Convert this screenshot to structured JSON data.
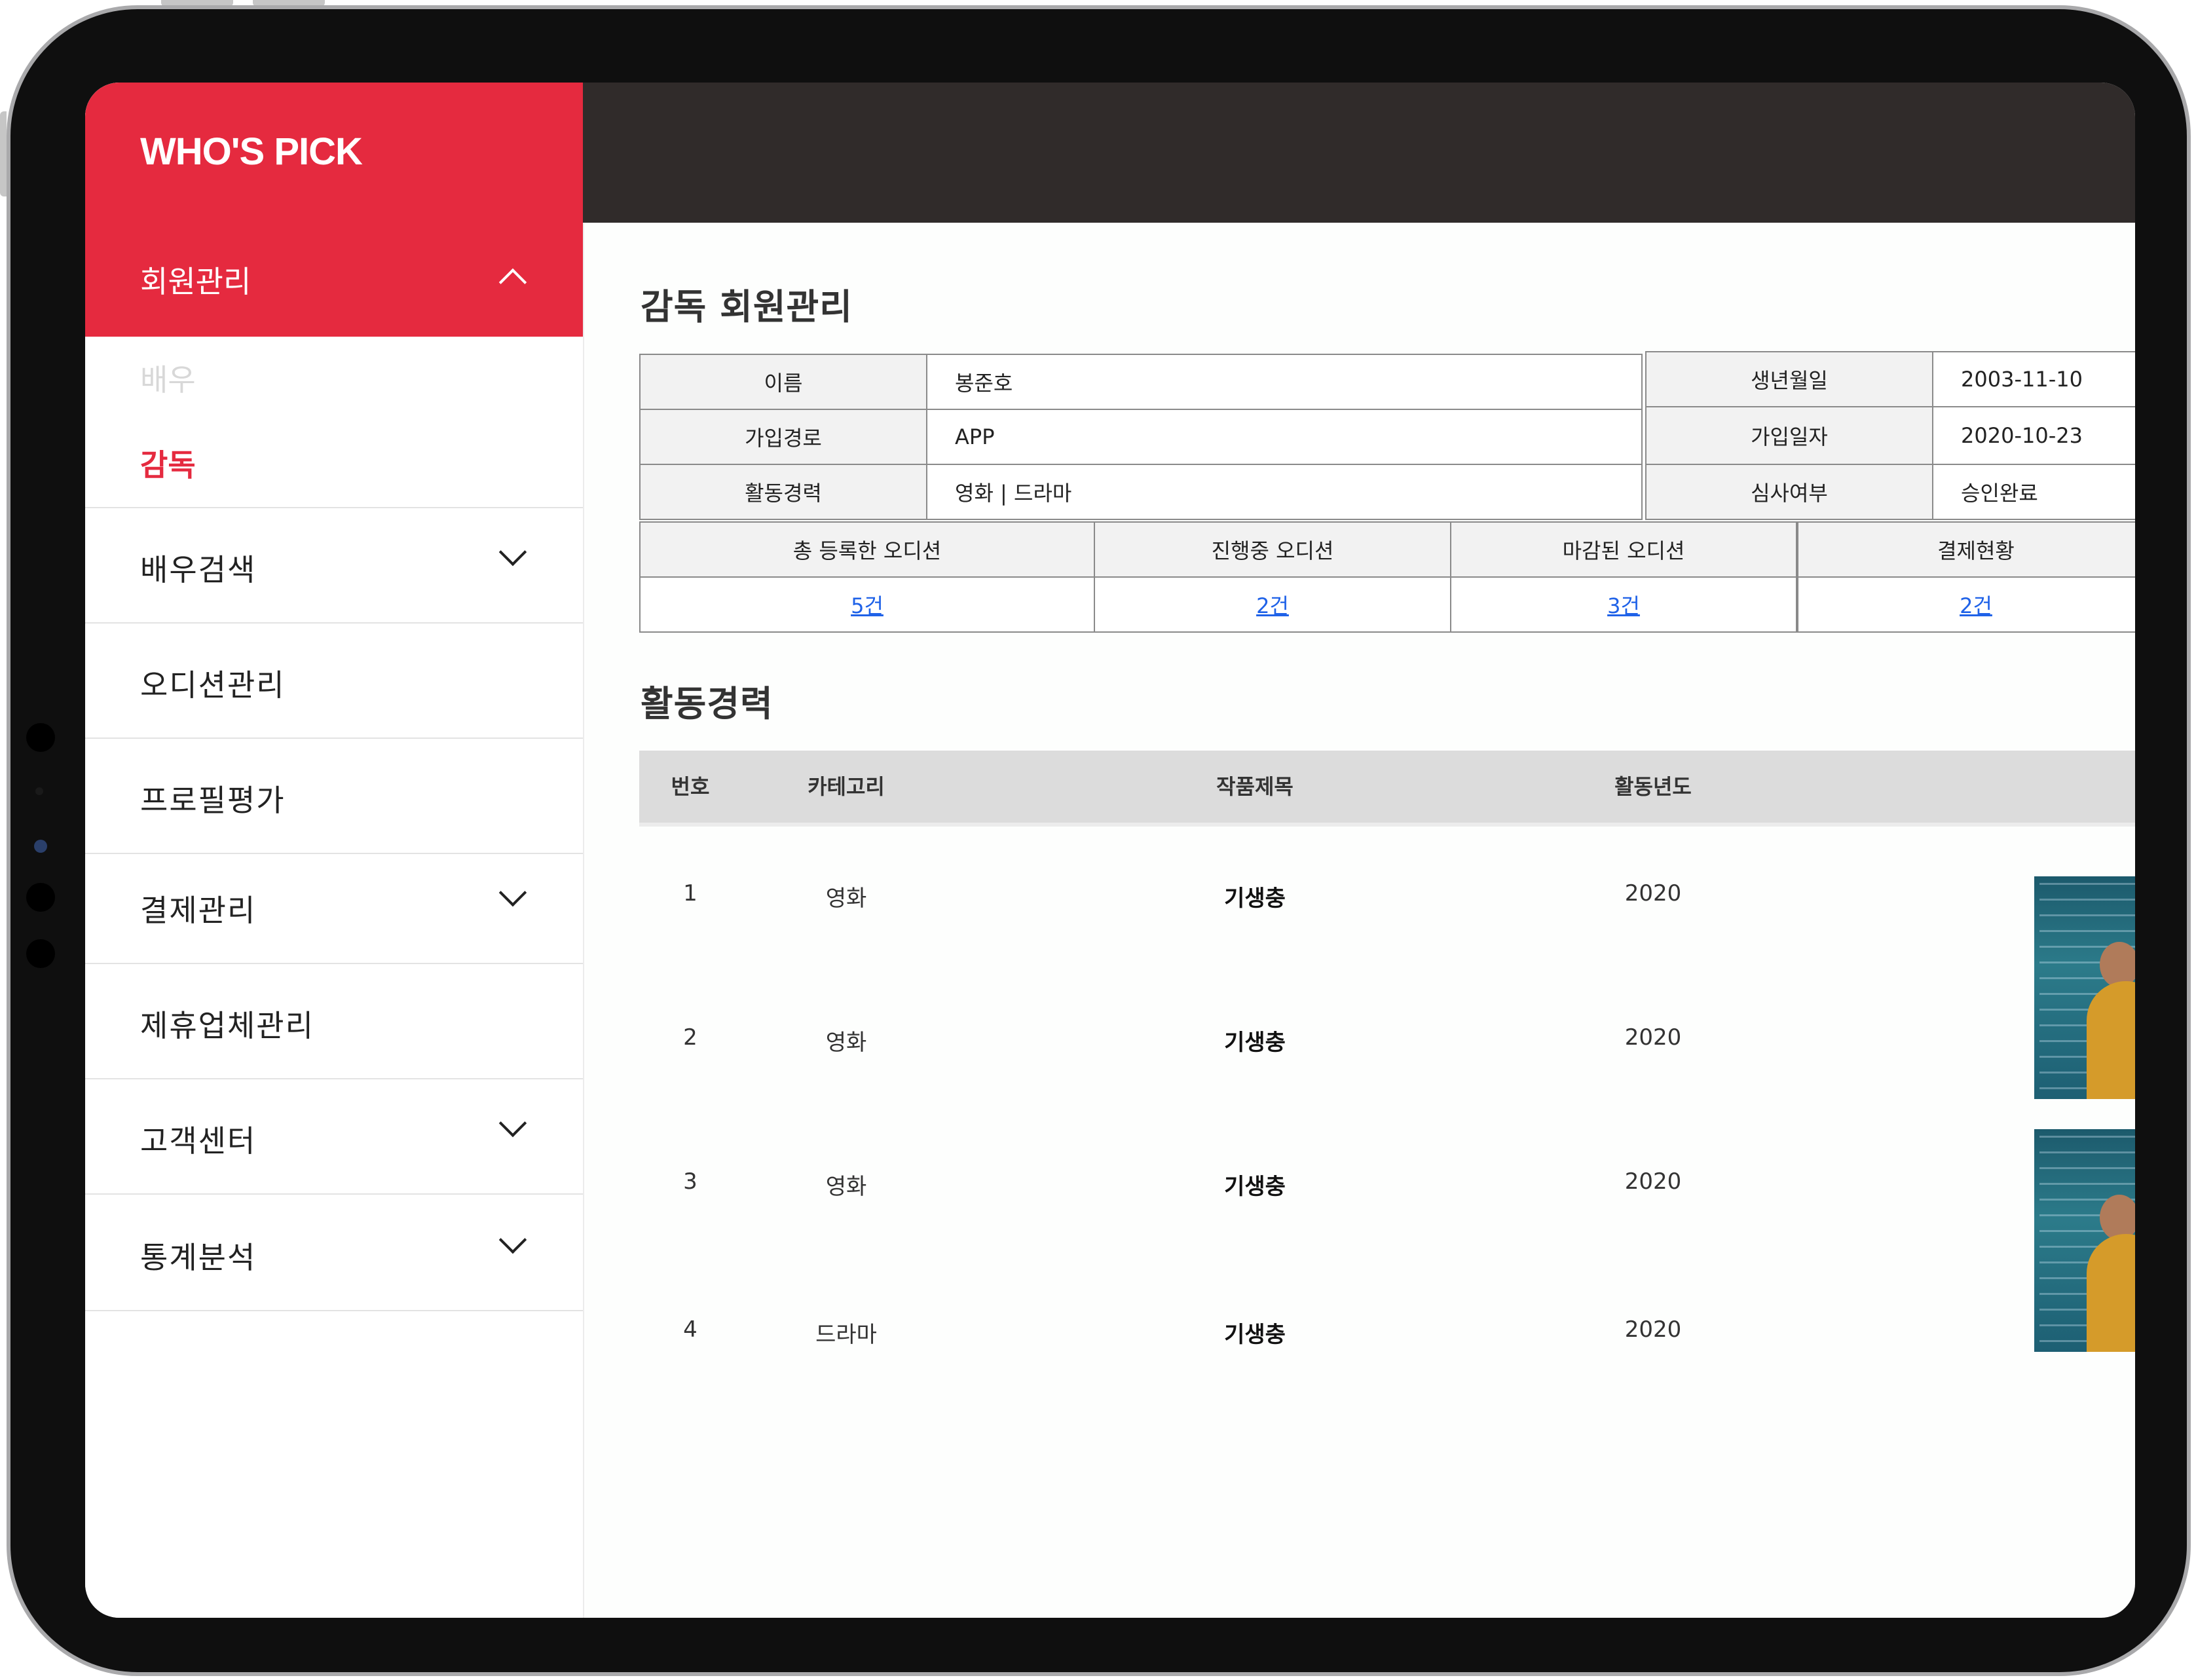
{
  "app": {
    "logo": "WHO'S PICK"
  },
  "sidebar": {
    "open_menu": "회원관리",
    "sub_items": [
      {
        "label": "배우",
        "active": false
      },
      {
        "label": "감독",
        "active": true
      }
    ],
    "items": [
      {
        "label": "배우검색",
        "has_chevron": true
      },
      {
        "label": "오디션관리",
        "has_chevron": false
      },
      {
        "label": "프로필평가",
        "has_chevron": false
      },
      {
        "label": "결제관리",
        "has_chevron": true
      },
      {
        "label": "제휴업체관리",
        "has_chevron": false
      },
      {
        "label": "고객센터",
        "has_chevron": true
      },
      {
        "label": "통계분석",
        "has_chevron": true
      }
    ]
  },
  "member": {
    "title": "감독 회원관리",
    "name_label": "이름",
    "name_value": "봉준호",
    "birth_label": "생년월일",
    "birth_value": "2003-11-10",
    "route_label": "가입경로",
    "route_value": "APP",
    "join_label": "가입일자",
    "join_value": "2020-10-23",
    "career_label": "활동경력",
    "career_value": "영화 | 드라마",
    "review_label": "심사여부",
    "review_value": "승인완료"
  },
  "stats": {
    "total_label": "총 등록한 오디션",
    "total_value": "5건",
    "ongoing_label": "진행중 오디션",
    "ongoing_value": "2건",
    "closed_label": "마감된 오디션",
    "closed_value": "3건",
    "payment_label": "결제현황",
    "payment_value": "2건"
  },
  "activity": {
    "title": "활동경력",
    "columns": [
      "번호",
      "카테고리",
      "작품제목",
      "활동년도"
    ],
    "rows": [
      {
        "no": "1",
        "category": "영화",
        "work": "기생충",
        "year": "2020"
      },
      {
        "no": "2",
        "category": "영화",
        "work": "기생충",
        "year": "2020"
      },
      {
        "no": "3",
        "category": "영화",
        "work": "기생충",
        "year": "2020"
      },
      {
        "no": "4",
        "category": "드라마",
        "work": "기생충",
        "year": "2020"
      }
    ]
  },
  "colors": {
    "brand": "#e52a3f",
    "header": "#302b2a",
    "link": "#1f62e8"
  }
}
